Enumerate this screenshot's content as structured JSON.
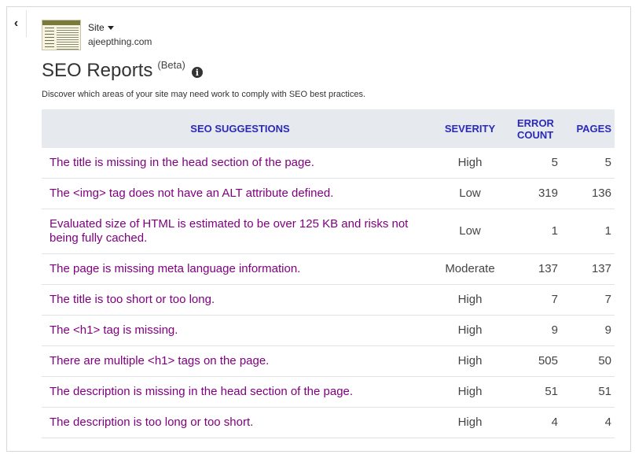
{
  "site": {
    "label": "Site",
    "domain": "ajeepthing.com"
  },
  "header": {
    "title": "SEO Reports",
    "badge": "(Beta)",
    "description": "Discover which areas of your site may need work to comply with SEO best practices."
  },
  "table": {
    "columns": {
      "suggestions": "SEO SUGGESTIONS",
      "severity": "SEVERITY",
      "error_count_line1": "ERROR",
      "error_count_line2": "COUNT",
      "pages": "PAGES"
    },
    "rows": [
      {
        "suggestion": "The title is missing in the head section of the page.",
        "severity": "High",
        "error_count": "5",
        "pages": "5"
      },
      {
        "suggestion": "The <img> tag does not have an ALT attribute defined.",
        "severity": "Low",
        "error_count": "319",
        "pages": "136"
      },
      {
        "suggestion": "Evaluated size of HTML is estimated to be over 125 KB and risks not being fully cached.",
        "severity": "Low",
        "error_count": "1",
        "pages": "1"
      },
      {
        "suggestion": "The page is missing meta language information.",
        "severity": "Moderate",
        "error_count": "137",
        "pages": "137"
      },
      {
        "suggestion": "The title is too short or too long.",
        "severity": "High",
        "error_count": "7",
        "pages": "7"
      },
      {
        "suggestion": "The <h1> tag is missing.",
        "severity": "High",
        "error_count": "9",
        "pages": "9"
      },
      {
        "suggestion": "There are multiple <h1> tags on the page.",
        "severity": "High",
        "error_count": "505",
        "pages": "50"
      },
      {
        "suggestion": "The description is missing in the head section of the page.",
        "severity": "High",
        "error_count": "51",
        "pages": "51"
      },
      {
        "suggestion": "The description is too long or too short.",
        "severity": "High",
        "error_count": "4",
        "pages": "4"
      }
    ]
  },
  "icons": {
    "collapse": "chevron-left-icon",
    "info": "info-icon",
    "dropdown": "caret-down-icon"
  },
  "colors": {
    "link_purple": "#800080",
    "header_blue": "#2a2ab8",
    "header_bg": "#e6e9ee"
  }
}
